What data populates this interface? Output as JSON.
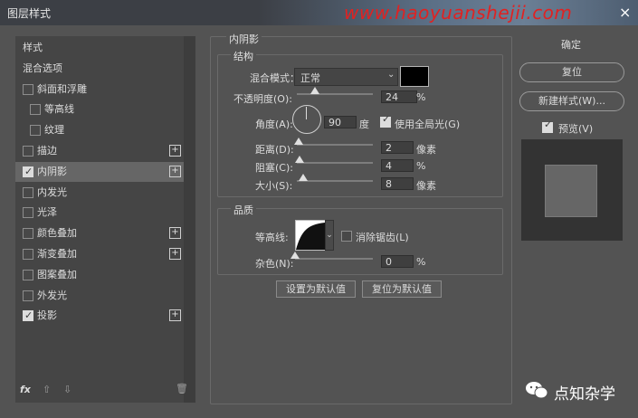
{
  "window": {
    "title": "图层样式",
    "close": "×",
    "watermark_url": "www.haoyuanshejii.com"
  },
  "sidebar": {
    "items": [
      {
        "label": "样式",
        "checkbox": false,
        "indent": 0,
        "plus": false
      },
      {
        "label": "混合选项",
        "checkbox": false,
        "indent": 0,
        "plus": false
      },
      {
        "label": "斜面和浮雕",
        "checkbox": true,
        "checked": false,
        "indent": 0,
        "plus": false
      },
      {
        "label": "等高线",
        "checkbox": true,
        "checked": false,
        "indent": 1,
        "plus": false
      },
      {
        "label": "纹理",
        "checkbox": true,
        "checked": false,
        "indent": 1,
        "plus": false
      },
      {
        "label": "描边",
        "checkbox": true,
        "checked": false,
        "indent": 0,
        "plus": true
      },
      {
        "label": "内阴影",
        "checkbox": true,
        "checked": true,
        "indent": 0,
        "plus": true,
        "selected": true
      },
      {
        "label": "内发光",
        "checkbox": true,
        "checked": false,
        "indent": 0,
        "plus": false
      },
      {
        "label": "光泽",
        "checkbox": true,
        "checked": false,
        "indent": 0,
        "plus": false
      },
      {
        "label": "颜色叠加",
        "checkbox": true,
        "checked": false,
        "indent": 0,
        "plus": true
      },
      {
        "label": "渐变叠加",
        "checkbox": true,
        "checked": false,
        "indent": 0,
        "plus": true
      },
      {
        "label": "图案叠加",
        "checkbox": true,
        "checked": false,
        "indent": 0,
        "plus": false
      },
      {
        "label": "外发光",
        "checkbox": true,
        "checked": false,
        "indent": 0,
        "plus": false
      },
      {
        "label": "投影",
        "checkbox": true,
        "checked": true,
        "indent": 0,
        "plus": true
      }
    ],
    "footer": {
      "fx": "fx",
      "up": "⇧",
      "down": "⇩",
      "trash": "🗑"
    }
  },
  "inner_shadow": {
    "section_title": "内阴影",
    "structure": {
      "title": "结构",
      "blend_mode_label": "混合模式：",
      "blend_mode_value": "正常",
      "color": "#000000",
      "opacity_label": "不透明度(O):",
      "opacity_value": "24",
      "opacity_unit": "%",
      "opacity_level": 24,
      "angle_label": "角度(A):",
      "angle_value": "90",
      "angle_unit": "度",
      "global_light_label": "使用全局光(G)",
      "global_light_checked": true,
      "distance_label": "距离(D):",
      "distance_value": "2",
      "distance_unit": "像素",
      "distance_level": 2,
      "choke_label": "阻塞(C):",
      "choke_value": "4",
      "choke_unit": "%",
      "choke_level": 4,
      "size_label": "大小(S):",
      "size_value": "8",
      "size_unit": "像素",
      "size_level": 8
    },
    "quality": {
      "title": "品质",
      "contour_label": "等高线:",
      "antialias_label": "消除锯齿(L)",
      "antialias_checked": false,
      "noise_label": "杂色(N):",
      "noise_value": "0",
      "noise_unit": "%",
      "noise_level": 0
    },
    "set_default_label": "设置为默认值",
    "reset_default_label": "复位为默认值"
  },
  "right": {
    "ok_label": "确定",
    "reset_label": "复位",
    "new_style_label": "新建样式(W)...",
    "preview_label": "预览(V)",
    "preview_checked": true
  },
  "brand": {
    "wechat_name": "点知杂学"
  }
}
